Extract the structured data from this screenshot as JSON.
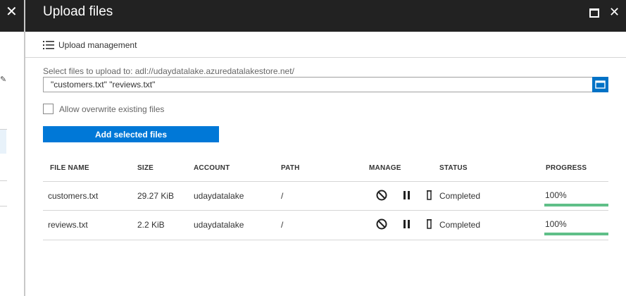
{
  "blade": {
    "title": "Upload files",
    "maximize_icon": "maximize-icon",
    "close_icon": "close-icon"
  },
  "left_blade": {
    "close_icon": "close-icon",
    "edit_icon": "pencil-icon"
  },
  "command_bar": {
    "upload_management_label": "Upload management",
    "upload_management_icon": "list-icon"
  },
  "form": {
    "select_label": "Select files to upload to: adl://udaydatalake.azuredatalakestore.net/",
    "files_value": "\"customers.txt\" \"reviews.txt\"",
    "browse_icon": "folder-icon",
    "overwrite_label": "Allow overwrite existing files",
    "overwrite_checked": false,
    "add_button_label": "Add selected files"
  },
  "table": {
    "headers": {
      "file_name": "FILE NAME",
      "size": "SIZE",
      "account": "ACCOUNT",
      "path": "PATH",
      "manage": "MANAGE",
      "status": "STATUS",
      "progress": "PROGRESS"
    },
    "rows": [
      {
        "file_name": "customers.txt",
        "size": "29.27 KiB",
        "account": "udaydatalake",
        "path": "/",
        "status": "Completed",
        "progress_text": "100%",
        "progress": 1.0
      },
      {
        "file_name": "reviews.txt",
        "size": "2.2 KiB",
        "account": "udaydatalake",
        "path": "/",
        "status": "Completed",
        "progress_text": "100%",
        "progress": 1.0
      }
    ]
  },
  "colors": {
    "header_bg": "#222222",
    "accent_blue": "#0078d7",
    "progress_green": "#5fbf88"
  }
}
